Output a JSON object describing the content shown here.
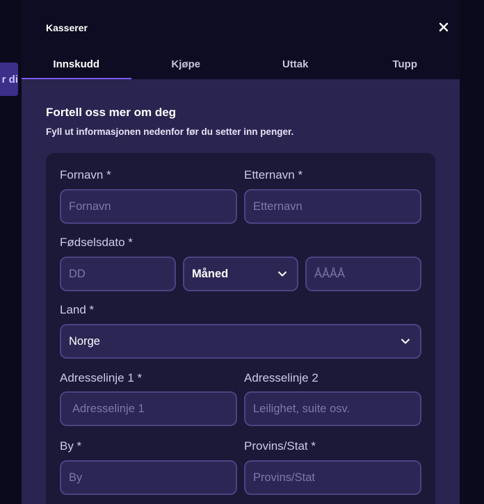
{
  "background": {
    "left_button_label": "r di"
  },
  "modal": {
    "title": "Kasserer",
    "tabs": [
      {
        "label": "Innskudd",
        "active": true
      },
      {
        "label": "Kjøpe",
        "active": false
      },
      {
        "label": "Uttak",
        "active": false
      },
      {
        "label": "Tupp",
        "active": false
      }
    ],
    "heading": "Fortell oss mer om deg",
    "subheading": "Fyll ut informasjonen nedenfor før du setter inn penger.",
    "form": {
      "first_name": {
        "label": "Fornavn *",
        "placeholder": "Fornavn"
      },
      "last_name": {
        "label": "Etternavn *",
        "placeholder": "Etternavn"
      },
      "birthdate": {
        "label": "Fødselsdato *",
        "day_placeholder": "DD",
        "month_value": "Måned",
        "year_placeholder": "ÅÅÅÅ"
      },
      "country": {
        "label": "Land *",
        "value": "Norge"
      },
      "address1": {
        "label": "Adresselinje 1 *",
        "placeholder": "Adresselinje 1"
      },
      "address2": {
        "label": "Adresselinje 2",
        "placeholder": "Leilighet, suite osv."
      },
      "city": {
        "label": "By *",
        "placeholder": "By"
      },
      "province": {
        "label": "Provins/Stat *",
        "placeholder": "Provins/Stat"
      }
    }
  },
  "colors": {
    "accent": "#7a5af5",
    "panel": "#2a2450",
    "card": "#1c1838",
    "field_border": "#4b4382"
  }
}
